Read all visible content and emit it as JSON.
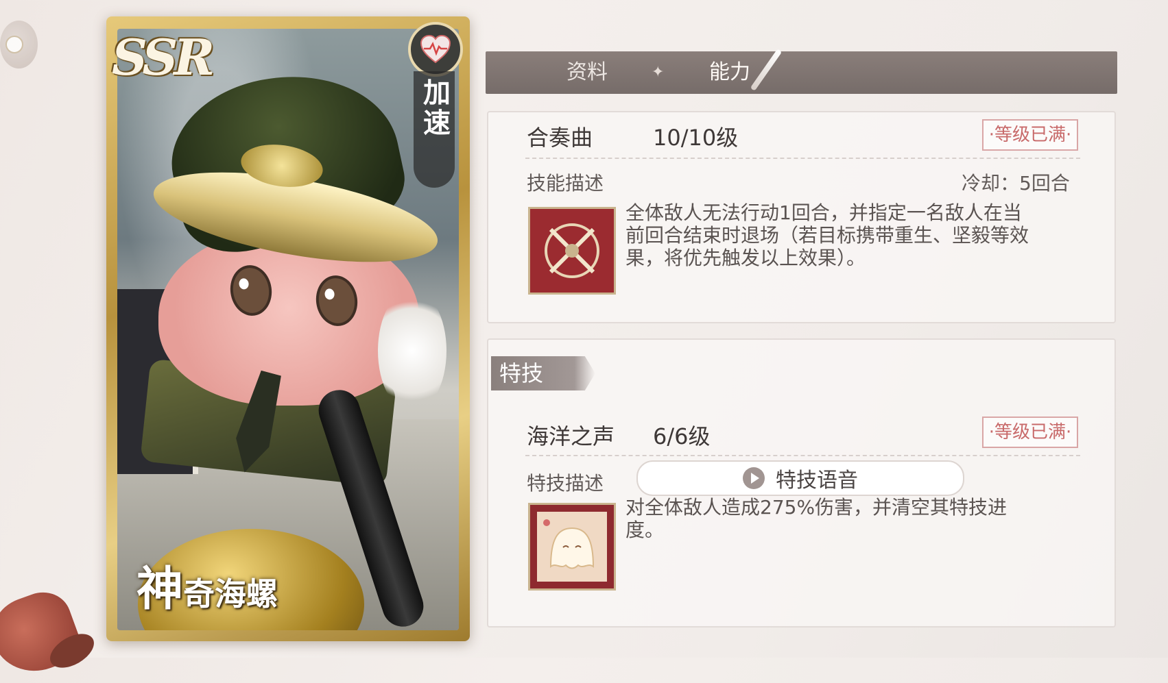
{
  "card": {
    "rarity": "SSR",
    "role": "加速",
    "name_first": "神",
    "name_rest": "奇海螺"
  },
  "tabs": {
    "info": "资料",
    "separator": "✦",
    "ability": "能力"
  },
  "skill": {
    "name": "合奏曲",
    "level": "10/10级",
    "status": "·等级已满·",
    "desc_label": "技能描述",
    "cooldown": "冷却：5回合",
    "description_lines": [
      "全体敌人无法行动1回合，并指定一名敌人在当",
      "前回合结束时退场（若目标携带重生、坚毅等效",
      "果，将优先触发以上效果）。"
    ]
  },
  "special": {
    "tag": "特技",
    "name": "海洋之声",
    "level": "6/6级",
    "status": "·等级已满·",
    "desc_label": "特技描述",
    "voice_label": "特技语音",
    "description_lines": [
      "对全体敌人造成275%伤害，并清空其特技进",
      "度。"
    ]
  },
  "colors": {
    "badge_red": "#c86a6a",
    "tabbar": "#7d7370",
    "skill_icon_bg": "#9b2b30"
  }
}
